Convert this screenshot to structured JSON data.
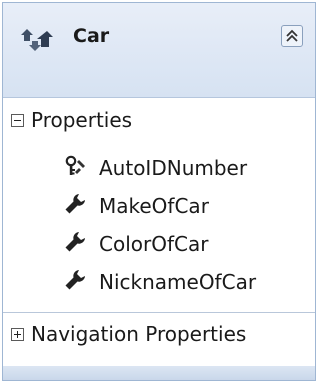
{
  "entity": {
    "title": "Car",
    "icon": "entity-icon",
    "collapse_icon": "double-chevron-up-icon"
  },
  "sections": {
    "properties": {
      "label": "Properties",
      "expanded": true,
      "items": [
        {
          "label": "AutoIDNumber",
          "icon": "key-wrench-icon"
        },
        {
          "label": "MakeOfCar",
          "icon": "wrench-icon"
        },
        {
          "label": "ColorOfCar",
          "icon": "wrench-icon"
        },
        {
          "label": "NicknameOfCar",
          "icon": "wrench-icon"
        }
      ]
    },
    "navigation": {
      "label": "Navigation Properties",
      "expanded": false
    }
  }
}
